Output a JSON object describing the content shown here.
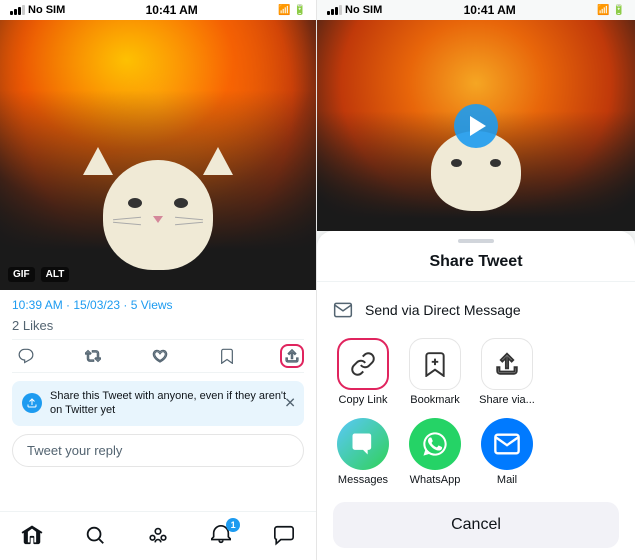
{
  "left": {
    "status_bar": {
      "carrier": "No SIM",
      "time": "10:41 AM",
      "battery": "charging"
    },
    "image_badges": [
      "GIF",
      "ALT"
    ],
    "tweet_meta": "10:39 AM · 15/03/23 · ",
    "tweet_views": "5 Views",
    "tweet_likes_count": "2",
    "tweet_likes_label": "Likes",
    "actions": {
      "reply": "",
      "retweet": "",
      "like": "",
      "bookmark": "",
      "share": ""
    },
    "share_banner_text": "Share this Tweet with anyone, even if they aren't on Twitter yet",
    "reply_placeholder": "Tweet your reply",
    "bottom_nav": {
      "home": "🏠",
      "search": "🔍",
      "emoji": "☺",
      "bell": "🔔",
      "mail": "✉"
    },
    "notification_count": "1"
  },
  "right": {
    "status_bar": {
      "carrier": "No SIM",
      "time": "10:41 AM",
      "battery": "charging"
    },
    "sheet_title": "Share Tweet",
    "direct_message_label": "Send via Direct Message",
    "share_options": [
      {
        "id": "copy-link",
        "label": "Copy Link",
        "highlighted": true
      },
      {
        "id": "bookmark",
        "label": "Bookmark",
        "highlighted": false
      },
      {
        "id": "share-via",
        "label": "Share via...",
        "highlighted": false
      }
    ],
    "social_options": [
      {
        "id": "messages",
        "label": "Messages",
        "type": "messages"
      },
      {
        "id": "whatsapp",
        "label": "WhatsApp",
        "type": "whatsapp"
      },
      {
        "id": "mail",
        "label": "Mail",
        "type": "mail"
      }
    ],
    "cancel_label": "Cancel"
  }
}
